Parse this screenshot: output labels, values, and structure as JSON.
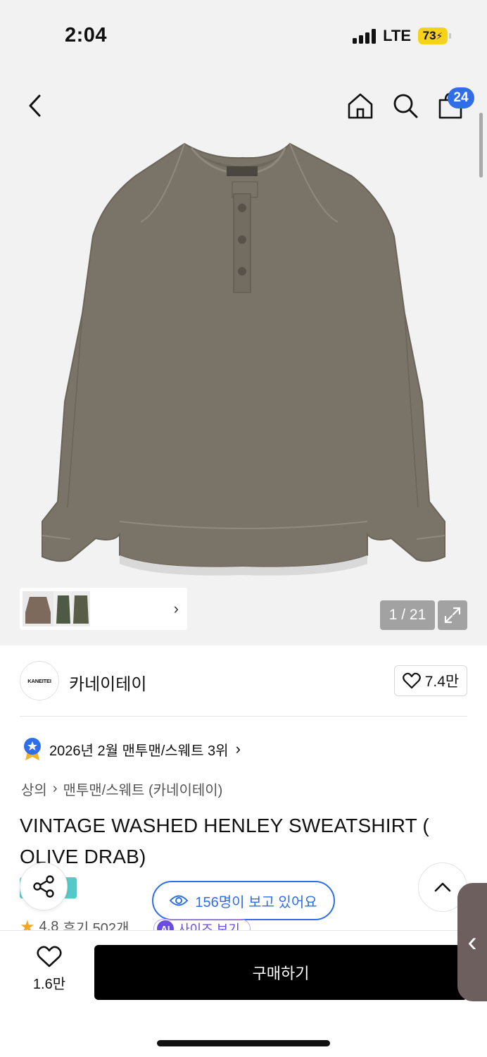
{
  "status_bar": {
    "time": "2:04",
    "network": "LTE",
    "battery": "73"
  },
  "header": {
    "cart_count": "24"
  },
  "gallery": {
    "counter": "1 / 21"
  },
  "brand": {
    "logo_text": "KANEITEI",
    "name": "카네이테이",
    "likes": "7.4만"
  },
  "ranking": {
    "text": "2026년 2월 맨투맨/스웨트 3위"
  },
  "breadcrumb": {
    "level1": "상의",
    "level2": "맨투맨/스웨트 (카네이테이)"
  },
  "product": {
    "title": "VINTAGE WASHED HENLEY SWEATSHIRT ( OLIVE DRAB)"
  },
  "viewers": {
    "text": "156명이 보고 있어요"
  },
  "rating": {
    "score": "4.8",
    "reviews": "후기 502개"
  },
  "size_ai": {
    "badge": "AI",
    "label": "사이즈 보기"
  },
  "bottom": {
    "wish_count": "1.6만",
    "buy_label": "구매하기"
  },
  "colors": {
    "accent": "#2f6ee6",
    "product": "#7a7468",
    "buy_bg": "#000000"
  }
}
